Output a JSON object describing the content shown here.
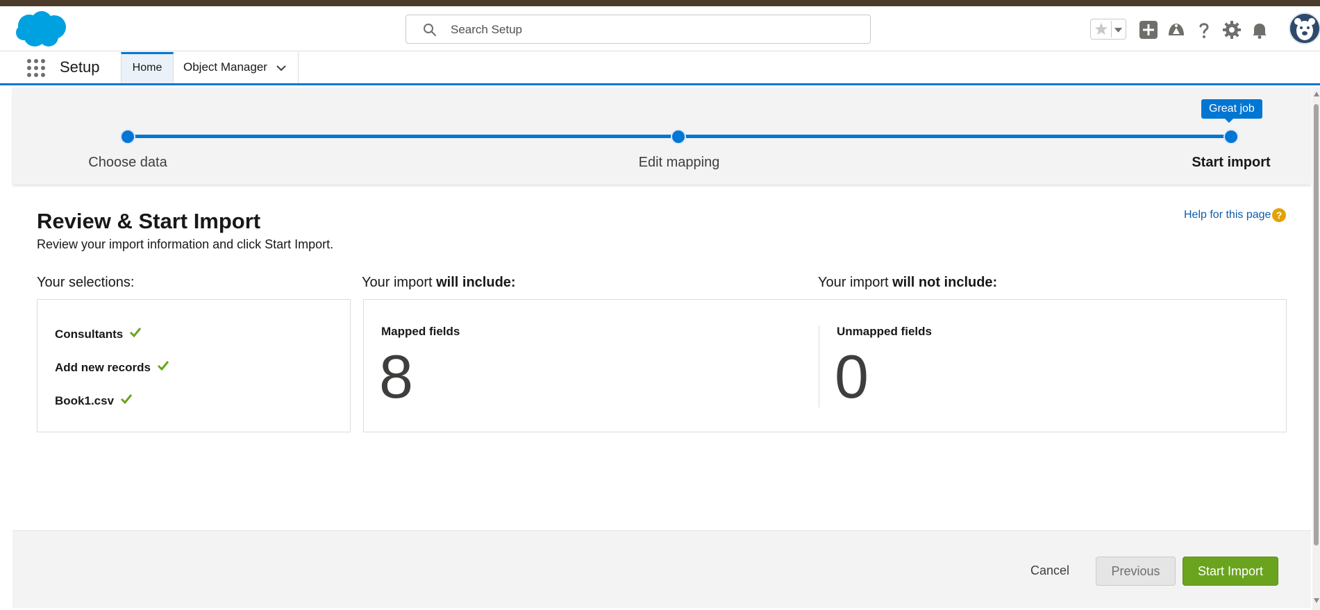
{
  "header": {
    "search_placeholder": "Search Setup",
    "icons": [
      "favorites-star-icon",
      "chevron-down-icon",
      "add-icon",
      "trailhead-icon",
      "help-icon",
      "gear-icon",
      "bell-icon",
      "avatar"
    ]
  },
  "nav": {
    "app_title": "Setup",
    "tabs": [
      {
        "label": "Home",
        "active": true
      },
      {
        "label": "Object Manager",
        "active": false
      }
    ]
  },
  "progress": {
    "steps": [
      {
        "label": "Choose data"
      },
      {
        "label": "Edit mapping"
      },
      {
        "label": "Start import",
        "current": true
      }
    ],
    "tooltip": "Great job"
  },
  "page": {
    "title": "Review & Start Import",
    "subtitle": "Review your import information and click Start Import.",
    "help_link": "Help for this page",
    "help_icon": "?"
  },
  "selections": {
    "heading": "Your selections:",
    "items": [
      "Consultants",
      "Add new records",
      "Book1.csv"
    ]
  },
  "include": {
    "heading_prefix": "Your import",
    "heading_bold": "will include:",
    "label": "Mapped fields",
    "count": "8"
  },
  "exclude": {
    "heading_prefix": "Your import",
    "heading_bold": "will not include:",
    "label": "Unmapped fields",
    "count": "0"
  },
  "footer": {
    "cancel": "Cancel",
    "previous": "Previous",
    "start": "Start Import"
  },
  "colors": {
    "brand_blue": "#0176d3",
    "success_green": "#6aa41f",
    "check_green": "#6aa41f",
    "help_orange": "#e4a201"
  }
}
